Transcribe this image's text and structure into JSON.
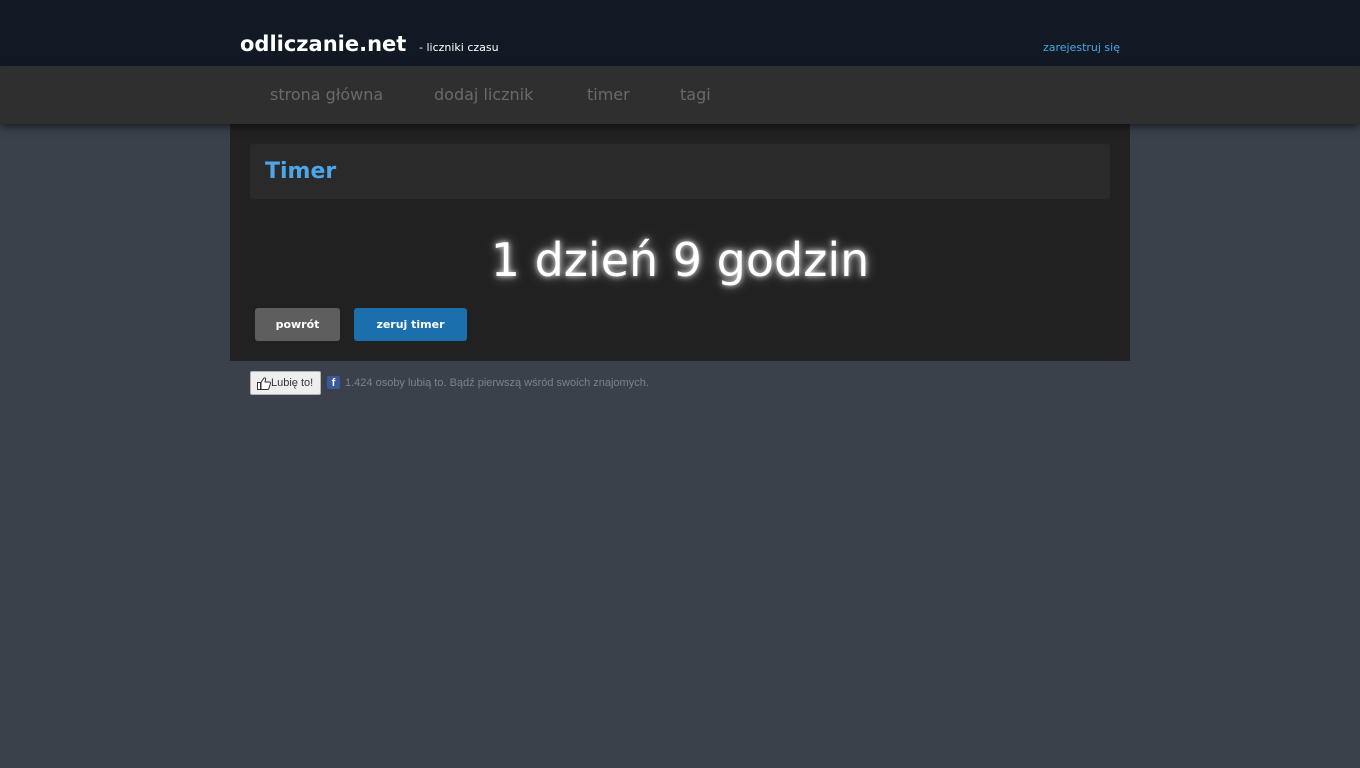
{
  "header": {
    "logo": "odliczanie.net",
    "tagline": "- liczniki czasu",
    "register_link": "zarejestruj się"
  },
  "nav": {
    "items": [
      {
        "label": "strona główna"
      },
      {
        "label": "dodaj licznik"
      },
      {
        "label": "timer"
      },
      {
        "label": "tagi"
      }
    ]
  },
  "main": {
    "title": "Timer",
    "timer_value": "1 dzień 9 godzin",
    "buttons": {
      "back_label": "powrót",
      "reset_label": "zeruj timer"
    }
  },
  "facebook": {
    "like_label": "Lubię to!",
    "icon_letter": "f",
    "text": "1.424 osoby lubią to. Bądź pierwszą wśród swoich znajomych."
  },
  "colors": {
    "page_background": "#3a414b",
    "header_background": "#111a24",
    "nav_background": "#302f2f",
    "panel_background": "#212121",
    "accent_blue": "#4da6e8",
    "reset_button": "#1c6fad",
    "back_button": "#5e5e5e"
  },
  "icons": {
    "like_button_icon": "thumbs-up-icon",
    "facebook_icon": "facebook-icon"
  }
}
